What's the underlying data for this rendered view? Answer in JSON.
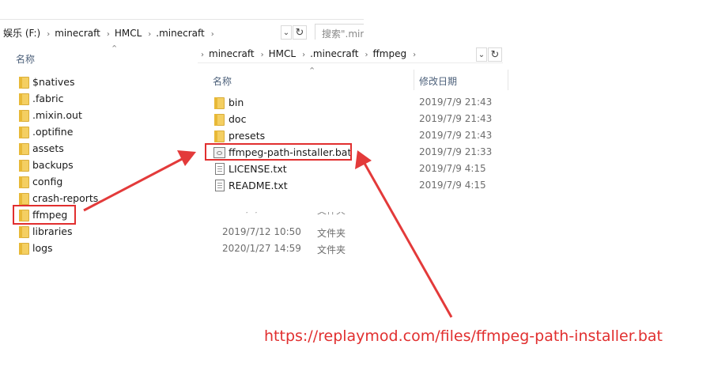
{
  "back_window": {
    "breadcrumbs": [
      "娱乐 (F:)",
      "minecraft",
      "HMCL",
      ".minecraft"
    ],
    "search_placeholder": "搜索\".mir",
    "column_name": "名称",
    "folders": [
      "$natives",
      ".fabric",
      ".mixin.out",
      ".optifine",
      "assets",
      "backups",
      "config",
      "crash-reports",
      "ffmpeg",
      "libraries",
      "logs"
    ],
    "rows": [
      {
        "date": "2019/7/12 10:50",
        "type": "文件夹"
      },
      {
        "date": "2020/1/27 14:59",
        "type": "文件夹"
      }
    ]
  },
  "front_window": {
    "breadcrumbs": [
      "minecraft",
      "HMCL",
      ".minecraft",
      "ffmpeg"
    ],
    "column_name": "名称",
    "column_date": "修改日期",
    "items": [
      {
        "name": "bin",
        "date": "2019/7/9 21:43",
        "icon": "folder-icon"
      },
      {
        "name": "doc",
        "date": "2019/7/9 21:43",
        "icon": "folder-icon"
      },
      {
        "name": "presets",
        "date": "2019/7/9 21:43",
        "icon": "folder-icon"
      },
      {
        "name": "ffmpeg-path-installer.bat",
        "date": "2019/7/9 21:33",
        "icon": "batch-file-icon"
      },
      {
        "name": "LICENSE.txt",
        "date": "2019/7/9 4:15",
        "icon": "text-file-icon"
      },
      {
        "name": "README.txt",
        "date": "2019/7/9 4:15",
        "icon": "text-file-icon"
      }
    ]
  },
  "annotation": {
    "url": "https://replaymod.com/files/ffmpeg-path-installer.bat",
    "color": "#e12f2f"
  }
}
